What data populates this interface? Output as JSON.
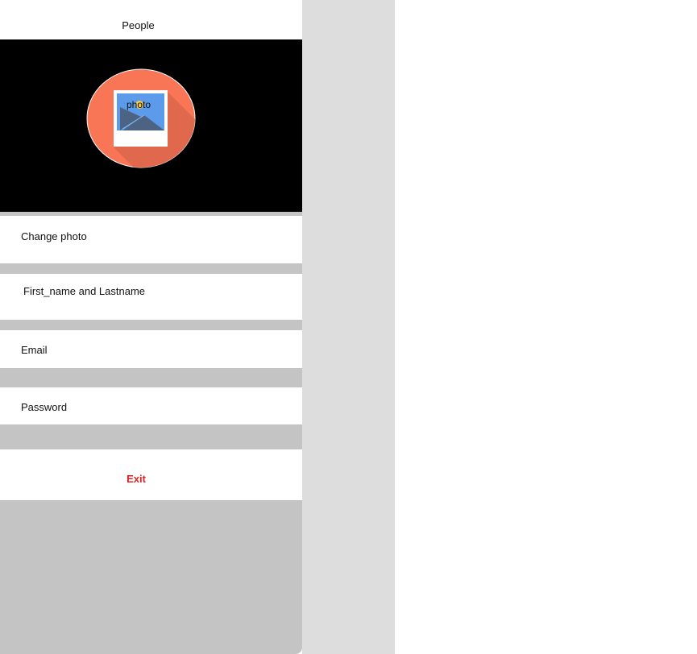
{
  "header": {
    "title": "People"
  },
  "profile_photo": {
    "placeholder_label": "photo",
    "circle_color": "#f87656",
    "frame_color": "#ffffff",
    "sky_color": "#5b9bea",
    "sun_color": "#f7c948",
    "mountain_color": "#4c6384"
  },
  "menu": {
    "change_photo_label": "Change photo",
    "name_label": "First_name and Lastname",
    "email_label": "Email",
    "password_label": "Password",
    "exit_label": "Exit"
  },
  "colors": {
    "separator": "#c4c4c4",
    "side_strip": "#dddddd",
    "exit_text": "#e02020"
  }
}
